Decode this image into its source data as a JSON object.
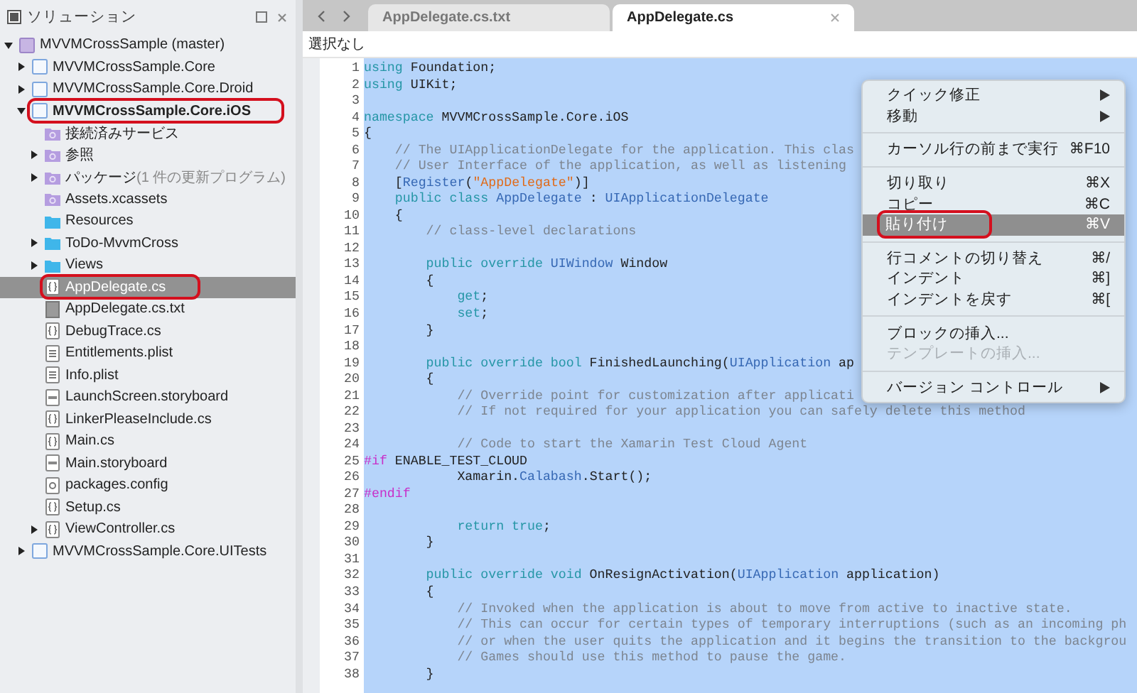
{
  "solution": {
    "title": "ソリューション",
    "items": [
      {
        "label": "MVVMCrossSample (master)",
        "kind": "solution",
        "expanded": true,
        "selected": false,
        "highlighted": false,
        "bold": false,
        "children": [
          {
            "label": "MVVMCrossSample.Core",
            "kind": "project",
            "expanded": false,
            "selected": false,
            "highlighted": false,
            "bold": false
          },
          {
            "label": "MVVMCrossSample.Core.Droid",
            "kind": "project",
            "expanded": false,
            "selected": false,
            "highlighted": false,
            "bold": false
          },
          {
            "label": "MVVMCrossSample.Core.iOS",
            "kind": "project",
            "expanded": true,
            "selected": false,
            "highlighted": true,
            "bold": true,
            "children": [
              {
                "label": "接続済みサービス",
                "kind": "special",
                "selected": false,
                "highlighted": false,
                "bold": false
              },
              {
                "label": "参照",
                "kind": "special",
                "expanded": false,
                "selected": false,
                "highlighted": false,
                "bold": false
              },
              {
                "label": "パッケージ",
                "note": "(1 件の更新プログラム)",
                "kind": "special",
                "expanded": false,
                "selected": false,
                "highlighted": false,
                "bold": false
              },
              {
                "label": "Assets.xcassets",
                "kind": "special",
                "selected": false,
                "highlighted": false,
                "bold": false
              },
              {
                "label": "Resources",
                "kind": "folder",
                "selected": false,
                "highlighted": false,
                "bold": false
              },
              {
                "label": "ToDo-MvvmCross",
                "kind": "folder",
                "expanded": false,
                "selected": false,
                "highlighted": false,
                "bold": false
              },
              {
                "label": "Views",
                "kind": "folder",
                "expanded": false,
                "selected": false,
                "highlighted": false,
                "bold": false
              },
              {
                "label": "AppDelegate.cs",
                "kind": "cs",
                "selected": true,
                "highlighted": true,
                "bold": false
              },
              {
                "label": "AppDelegate.cs.txt",
                "kind": "txt",
                "selected": false,
                "highlighted": false,
                "bold": false
              },
              {
                "label": "DebugTrace.cs",
                "kind": "cs",
                "selected": false,
                "highlighted": false,
                "bold": false
              },
              {
                "label": "Entitlements.plist",
                "kind": "plist",
                "selected": false,
                "highlighted": false,
                "bold": false
              },
              {
                "label": "Info.plist",
                "kind": "plist",
                "selected": false,
                "highlighted": false,
                "bold": false
              },
              {
                "label": "LaunchScreen.storyboard",
                "kind": "storyboard",
                "selected": false,
                "highlighted": false,
                "bold": false
              },
              {
                "label": "LinkerPleaseInclude.cs",
                "kind": "cs",
                "selected": false,
                "highlighted": false,
                "bold": false
              },
              {
                "label": "Main.cs",
                "kind": "cs",
                "selected": false,
                "highlighted": false,
                "bold": false
              },
              {
                "label": "Main.storyboard",
                "kind": "storyboard",
                "selected": false,
                "highlighted": false,
                "bold": false
              },
              {
                "label": "packages.config",
                "kind": "config",
                "selected": false,
                "highlighted": false,
                "bold": false
              },
              {
                "label": "Setup.cs",
                "kind": "cs",
                "selected": false,
                "highlighted": false,
                "bold": false
              },
              {
                "label": "ViewController.cs",
                "kind": "cs",
                "expanded": false,
                "selected": false,
                "highlighted": false,
                "bold": false
              }
            ]
          },
          {
            "label": "MVVMCrossSample.Core.UITests",
            "kind": "project",
            "expanded": false,
            "selected": false,
            "highlighted": false,
            "bold": false
          }
        ]
      }
    ]
  },
  "tabs": [
    {
      "label": "AppDelegate.cs.txt",
      "selected": false
    },
    {
      "label": "AppDelegate.cs",
      "selected": true
    }
  ],
  "breadcrumb": "選択なし",
  "code": [
    {
      "n": "1",
      "tokens": [
        {
          "kind": "kw",
          "text": "using"
        },
        {
          "kind": "plain",
          "text": " Foundation;"
        }
      ]
    },
    {
      "n": "2",
      "tokens": [
        {
          "kind": "kw",
          "text": "using"
        },
        {
          "kind": "plain",
          "text": " UIKit;"
        }
      ]
    },
    {
      "n": "3"
    },
    {
      "n": "4",
      "tokens": [
        {
          "kind": "kw",
          "text": "namespace"
        },
        {
          "kind": "plain",
          "text": " MVVMCrossSample.Core.iOS"
        }
      ]
    },
    {
      "n": "5",
      "tokens": [
        {
          "kind": "plain",
          "text": "{"
        }
      ]
    },
    {
      "n": "6",
      "tokens": [
        {
          "kind": "comment",
          "text": "    // The UIApplicationDelegate for the application. This clas"
        }
      ]
    },
    {
      "n": "7",
      "tokens": [
        {
          "kind": "comment",
          "text": "    // User Interface of the application, as well as listening"
        }
      ]
    },
    {
      "n": "8",
      "tokens": [
        {
          "kind": "plain",
          "text": "    ["
        },
        {
          "kind": "type",
          "text": "Register"
        },
        {
          "kind": "plain",
          "text": "("
        },
        {
          "kind": "string",
          "text": "\"AppDelegate\""
        },
        {
          "kind": "plain",
          "text": ")]"
        }
      ]
    },
    {
      "n": "9",
      "tokens": [
        {
          "kind": "kw",
          "text": "    public class"
        },
        {
          "kind": "type",
          "text": " AppDelegate"
        },
        {
          "kind": "plain",
          "text": " :"
        },
        {
          "kind": "type",
          "text": " UIApplicationDelegate"
        }
      ]
    },
    {
      "n": "10",
      "tokens": [
        {
          "kind": "plain",
          "text": "    {"
        }
      ]
    },
    {
      "n": "11",
      "tokens": [
        {
          "kind": "comment",
          "text": "        // class-level declarations"
        }
      ]
    },
    {
      "n": "12"
    },
    {
      "n": "13",
      "tokens": [
        {
          "kind": "kw",
          "text": "        public override"
        },
        {
          "kind": "type",
          "text": " UIWindow"
        },
        {
          "kind": "plain",
          "text": " Window"
        }
      ]
    },
    {
      "n": "14",
      "tokens": [
        {
          "kind": "plain",
          "text": "        {"
        }
      ]
    },
    {
      "n": "15",
      "tokens": [
        {
          "kind": "kw",
          "text": "            get"
        },
        {
          "kind": "plain",
          "text": ";"
        }
      ]
    },
    {
      "n": "16",
      "tokens": [
        {
          "kind": "kw",
          "text": "            set"
        },
        {
          "kind": "plain",
          "text": ";"
        }
      ]
    },
    {
      "n": "17",
      "tokens": [
        {
          "kind": "plain",
          "text": "        }"
        }
      ]
    },
    {
      "n": "18"
    },
    {
      "n": "19",
      "tokens": [
        {
          "kind": "kw",
          "text": "        public override bool"
        },
        {
          "kind": "plain",
          "text": " FinishedLaunching("
        },
        {
          "kind": "type",
          "text": "UIApplication"
        },
        {
          "kind": "plain",
          "text": " ap"
        }
      ]
    },
    {
      "n": "20",
      "tokens": [
        {
          "kind": "plain",
          "text": "        {"
        }
      ]
    },
    {
      "n": "21",
      "tokens": [
        {
          "kind": "comment",
          "text": "            // Override point for customization after applicati"
        }
      ]
    },
    {
      "n": "22",
      "tokens": [
        {
          "kind": "comment",
          "text": "            // If not required for your application you can safely delete this method"
        }
      ]
    },
    {
      "n": "23"
    },
    {
      "n": "24",
      "tokens": [
        {
          "kind": "comment",
          "text": "            // Code to start the Xamarin Test Cloud Agent"
        }
      ]
    },
    {
      "n": "25",
      "tokens": [
        {
          "kind": "directive",
          "text": "#if"
        },
        {
          "kind": "plain",
          "text": " ENABLE_TEST_CLOUD"
        }
      ]
    },
    {
      "n": "26",
      "tokens": [
        {
          "kind": "plain",
          "text": "            Xamarin."
        },
        {
          "kind": "type",
          "text": "Calabash"
        },
        {
          "kind": "plain",
          "text": ".Start();"
        }
      ]
    },
    {
      "n": "27",
      "tokens": [
        {
          "kind": "directive",
          "text": "#endif"
        }
      ]
    },
    {
      "n": "28"
    },
    {
      "n": "29",
      "tokens": [
        {
          "kind": "kw",
          "text": "            return true"
        },
        {
          "kind": "plain",
          "text": ";"
        }
      ]
    },
    {
      "n": "30",
      "tokens": [
        {
          "kind": "plain",
          "text": "        }"
        }
      ]
    },
    {
      "n": "31"
    },
    {
      "n": "32",
      "tokens": [
        {
          "kind": "kw",
          "text": "        public override void"
        },
        {
          "kind": "plain",
          "text": " OnResignActivation("
        },
        {
          "kind": "type",
          "text": "UIApplication"
        },
        {
          "kind": "plain",
          "text": " application)"
        }
      ]
    },
    {
      "n": "33",
      "tokens": [
        {
          "kind": "plain",
          "text": "        {"
        }
      ]
    },
    {
      "n": "34",
      "tokens": [
        {
          "kind": "comment",
          "text": "            // Invoked when the application is about to move from active to inactive state."
        }
      ]
    },
    {
      "n": "35",
      "tokens": [
        {
          "kind": "comment",
          "text": "            // This can occur for certain types of temporary interruptions (such as an incoming ph"
        }
      ]
    },
    {
      "n": "36",
      "tokens": [
        {
          "kind": "comment",
          "text": "            // or when the user quits the application and it begins the transition to the backgrou"
        }
      ]
    },
    {
      "n": "37",
      "tokens": [
        {
          "kind": "comment",
          "text": "            // Games should use this method to pause the game."
        }
      ]
    },
    {
      "n": "38",
      "tokens": [
        {
          "kind": "plain",
          "text": "        }"
        }
      ]
    }
  ],
  "context_menu": [
    {
      "kind": "item",
      "label": "クイック修正",
      "submenu": true,
      "selected": false,
      "highlighted": false,
      "disabled": false
    },
    {
      "kind": "item",
      "label": "移動",
      "submenu": true,
      "selected": false,
      "highlighted": false,
      "disabled": false
    },
    {
      "kind": "separator"
    },
    {
      "kind": "item",
      "label": "カーソル行の前まで実行",
      "shortcut": "⌘F10",
      "submenu": false,
      "selected": false,
      "highlighted": false,
      "disabled": false
    },
    {
      "kind": "separator"
    },
    {
      "kind": "item",
      "label": "切り取り",
      "shortcut": "⌘X",
      "submenu": false,
      "selected": false,
      "highlighted": false,
      "disabled": false
    },
    {
      "kind": "item",
      "label": "コピー",
      "shortcut": "⌘C",
      "submenu": false,
      "selected": false,
      "highlighted": false,
      "disabled": false
    },
    {
      "kind": "item",
      "label": "貼り付け",
      "shortcut": "⌘V",
      "submenu": false,
      "selected": true,
      "highlighted": true,
      "disabled": false
    },
    {
      "kind": "separator"
    },
    {
      "kind": "item",
      "label": "行コメントの切り替え",
      "shortcut": "⌘/",
      "submenu": false,
      "selected": false,
      "highlighted": false,
      "disabled": false
    },
    {
      "kind": "item",
      "label": "インデント",
      "shortcut": "⌘]",
      "submenu": false,
      "selected": false,
      "highlighted": false,
      "disabled": false
    },
    {
      "kind": "item",
      "label": "インデントを戻す",
      "shortcut": "⌘[",
      "submenu": false,
      "selected": false,
      "highlighted": false,
      "disabled": false
    },
    {
      "kind": "separator"
    },
    {
      "kind": "item",
      "label": "ブロックの挿入...",
      "submenu": false,
      "selected": false,
      "highlighted": false,
      "disabled": false
    },
    {
      "kind": "item",
      "label": "テンプレートの挿入...",
      "submenu": false,
      "selected": false,
      "highlighted": false,
      "disabled": true
    },
    {
      "kind": "separator"
    },
    {
      "kind": "item",
      "label": "バージョン コントロール",
      "submenu": true,
      "selected": false,
      "highlighted": false,
      "disabled": false
    }
  ]
}
